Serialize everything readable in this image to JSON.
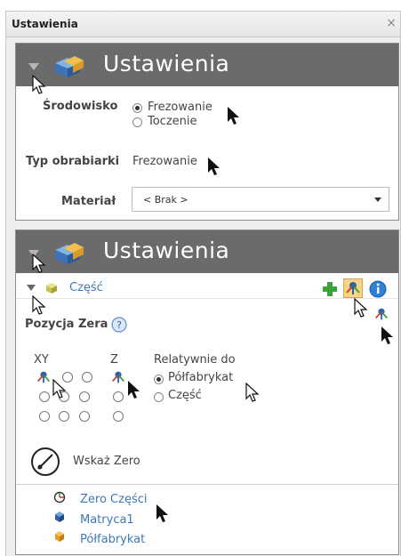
{
  "window": {
    "title": "Ustawienia",
    "close": "×"
  },
  "panel1": {
    "title": "Ustawienia",
    "env_label": "Środowisko",
    "env_options": [
      "Frezowanie",
      "Toczenie"
    ],
    "env_selected": "Frezowanie",
    "machine_label": "Typ obrabiarki",
    "machine_value": "Frezowanie",
    "material_label": "Materiał",
    "material_value": "< Brak >"
  },
  "panel2": {
    "title": "Ustawienia",
    "part_label": "Część",
    "zero_pos_label": "Pozycja Zera",
    "xy_label": "XY",
    "z_label": "Z",
    "relative_label": "Relatywnie do",
    "relative_options": [
      "Półfabrykat",
      "Część"
    ],
    "relative_selected": "Półfabrykat",
    "pick_zero_label": "Wskaż Zero",
    "tree": [
      "Zero Części",
      "Matryca1",
      "Półfabrykat"
    ]
  },
  "colors": {
    "header": "#6b6b6b",
    "link": "#3f78b6",
    "accent_green": "#3aa33a",
    "info_blue": "#2f7fd6"
  },
  "icons": [
    "close-icon",
    "collapse-triangle-icon",
    "part-box-icon",
    "add-icon",
    "zero-axis-icon",
    "info-icon",
    "help-icon",
    "target-icon",
    "tree-zero-icon",
    "tree-matrix-icon",
    "tree-stock-icon",
    "cursor-icon"
  ]
}
